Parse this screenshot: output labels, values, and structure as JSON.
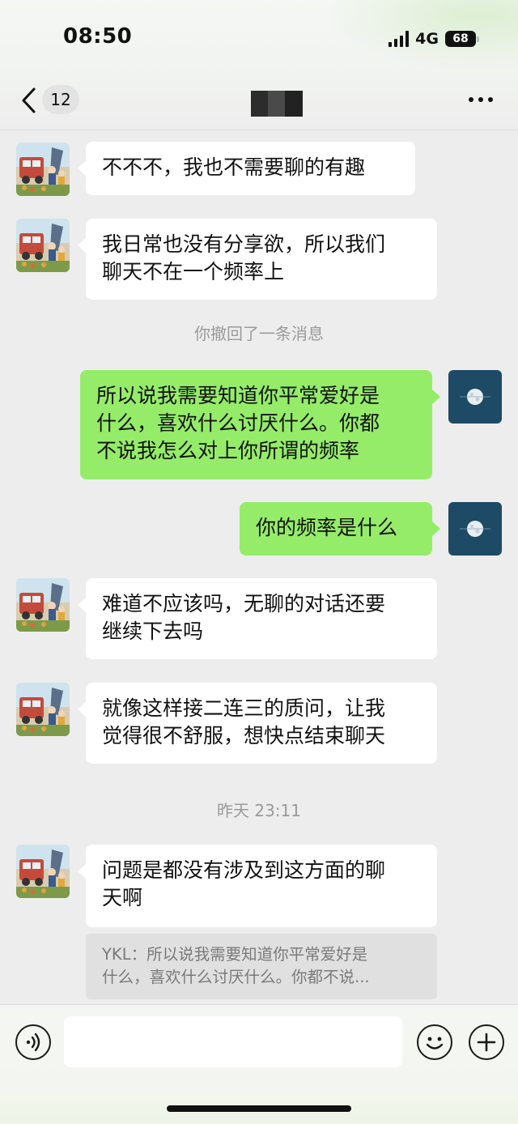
{
  "status_bar": {
    "time": "08:50",
    "network": "4G",
    "battery": "68"
  },
  "nav": {
    "back_count": "12"
  },
  "messages": [
    {
      "side": "left",
      "lines": [
        "不不不，我也不需要聊的有趣"
      ]
    },
    {
      "side": "left",
      "lines": [
        "我日常也没有分享欲，所以我们",
        "聊天不在一个频率上"
      ]
    },
    {
      "system": "你撤回了一条消息"
    },
    {
      "side": "right",
      "lines": [
        "所以说我需要知道你平常爱好是",
        "什么，喜欢什么讨厌什么。你都",
        "不说我怎么对上你所谓的频率"
      ]
    },
    {
      "side": "right",
      "lines": [
        "你的频率是什么"
      ]
    },
    {
      "side": "left",
      "lines": [
        "难道不应该吗，无聊的对话还要",
        "继续下去吗"
      ]
    },
    {
      "side": "left",
      "lines": [
        "就像这样接二连三的质问，让我",
        "觉得很不舒服，想快点结束聊天"
      ]
    },
    {
      "system": "昨天 23:11"
    },
    {
      "side": "left",
      "lines": [
        "问题是都没有涉及到这方面的聊",
        "天啊"
      ]
    }
  ],
  "quote": {
    "lines": [
      "YKL：所以说我需要知道你平常爱好是",
      "什么，喜欢什么讨厌什么。你都不说..."
    ]
  },
  "input_bar": {
    "voice_icon": "voice-icon",
    "emoji_icon": "emoji-icon",
    "add_icon": "plus-icon"
  },
  "colors": {
    "sent_bubble": "#95ec69",
    "received_bubble": "#ffffff",
    "background": "#ededed"
  }
}
